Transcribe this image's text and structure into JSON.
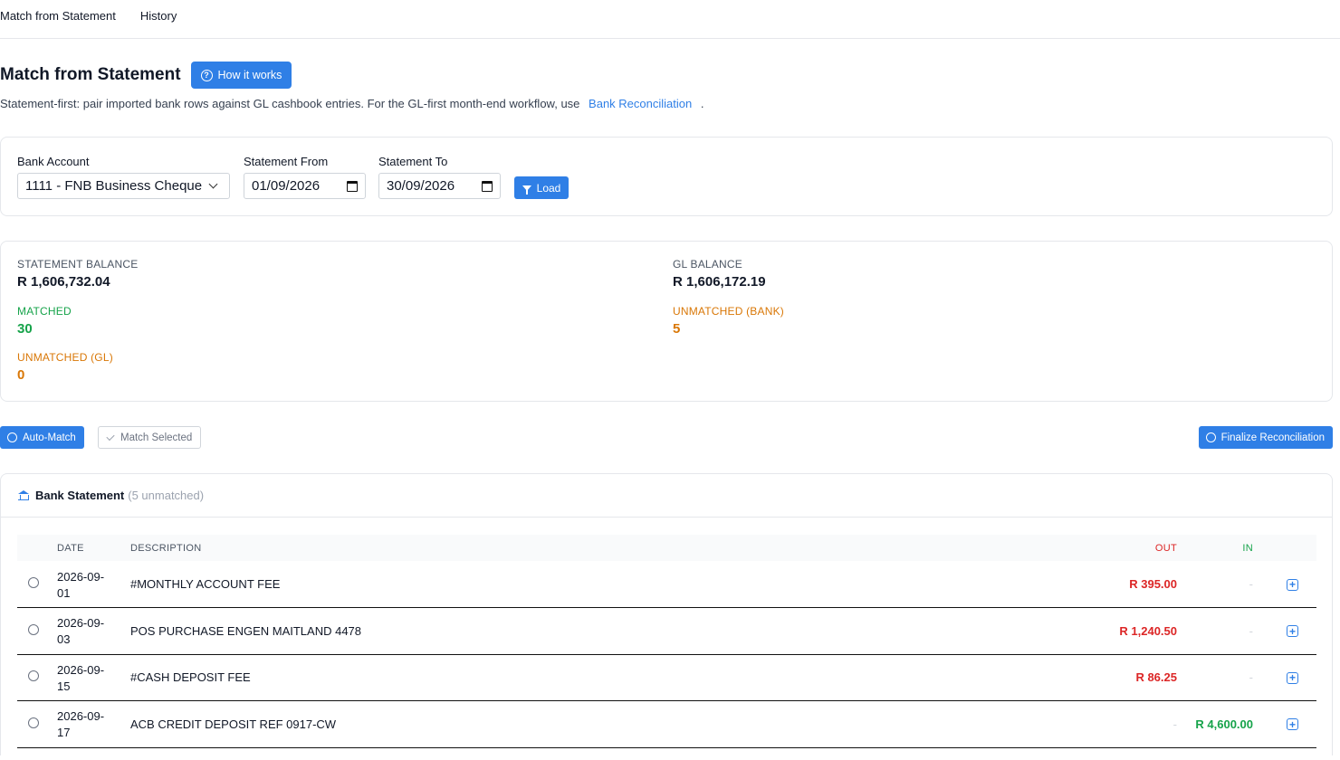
{
  "tabs": [
    {
      "label": "Match from Statement"
    },
    {
      "label": "History"
    }
  ],
  "header": {
    "title": "Match from Statement",
    "how_label": "How it works",
    "subtitle_prefix": "Statement-first: pair imported bank rows against GL cashbook entries. For the GL-first month-end workflow, use",
    "subtitle_link": "Bank Reconciliation",
    "subtitle_suffix": "."
  },
  "filters": {
    "bank_account_label": "Bank Account",
    "bank_account_value": "1111 - FNB Business Cheque",
    "from_label": "Statement From",
    "from_value": "01/09/2026",
    "to_label": "Statement To",
    "to_value": "30/09/2026",
    "load_label": "Load"
  },
  "summary": {
    "statement_balance_label": "STATEMENT BALANCE",
    "statement_balance": "R 1,606,732.04",
    "gl_balance_label": "GL BALANCE",
    "gl_balance": "R 1,606,172.19",
    "matched_label": "MATCHED",
    "matched": "30",
    "unmatched_bank_label": "UNMATCHED (BANK)",
    "unmatched_bank": "5",
    "unmatched_gl_label": "UNMATCHED (GL)",
    "unmatched_gl": "0"
  },
  "actions": {
    "auto_match": "Auto-Match",
    "match_selected": "Match Selected",
    "finalize": "Finalize Reconciliation"
  },
  "bank_statement": {
    "title": "Bank Statement",
    "count": "(5 unmatched)",
    "columns": {
      "date": "DATE",
      "description": "DESCRIPTION",
      "out": "OUT",
      "in": "IN"
    },
    "rows": [
      {
        "date_a": "2026-09-",
        "date_b": "01",
        "description": "#MONTHLY ACCOUNT FEE",
        "out": "R 395.00",
        "in": "-"
      },
      {
        "date_a": "2026-09-",
        "date_b": "03",
        "description": "POS PURCHASE ENGEN MAITLAND 4478",
        "out": "R 1,240.50",
        "in": "-"
      },
      {
        "date_a": "2026-09-",
        "date_b": "15",
        "description": "#CASH DEPOSIT FEE",
        "out": "R 86.25",
        "in": "-"
      },
      {
        "date_a": "2026-09-",
        "date_b": "17",
        "description": "ACB CREDIT DEPOSIT REF 0917-CW",
        "out": "-",
        "in": "R 4,600.00"
      }
    ]
  }
}
